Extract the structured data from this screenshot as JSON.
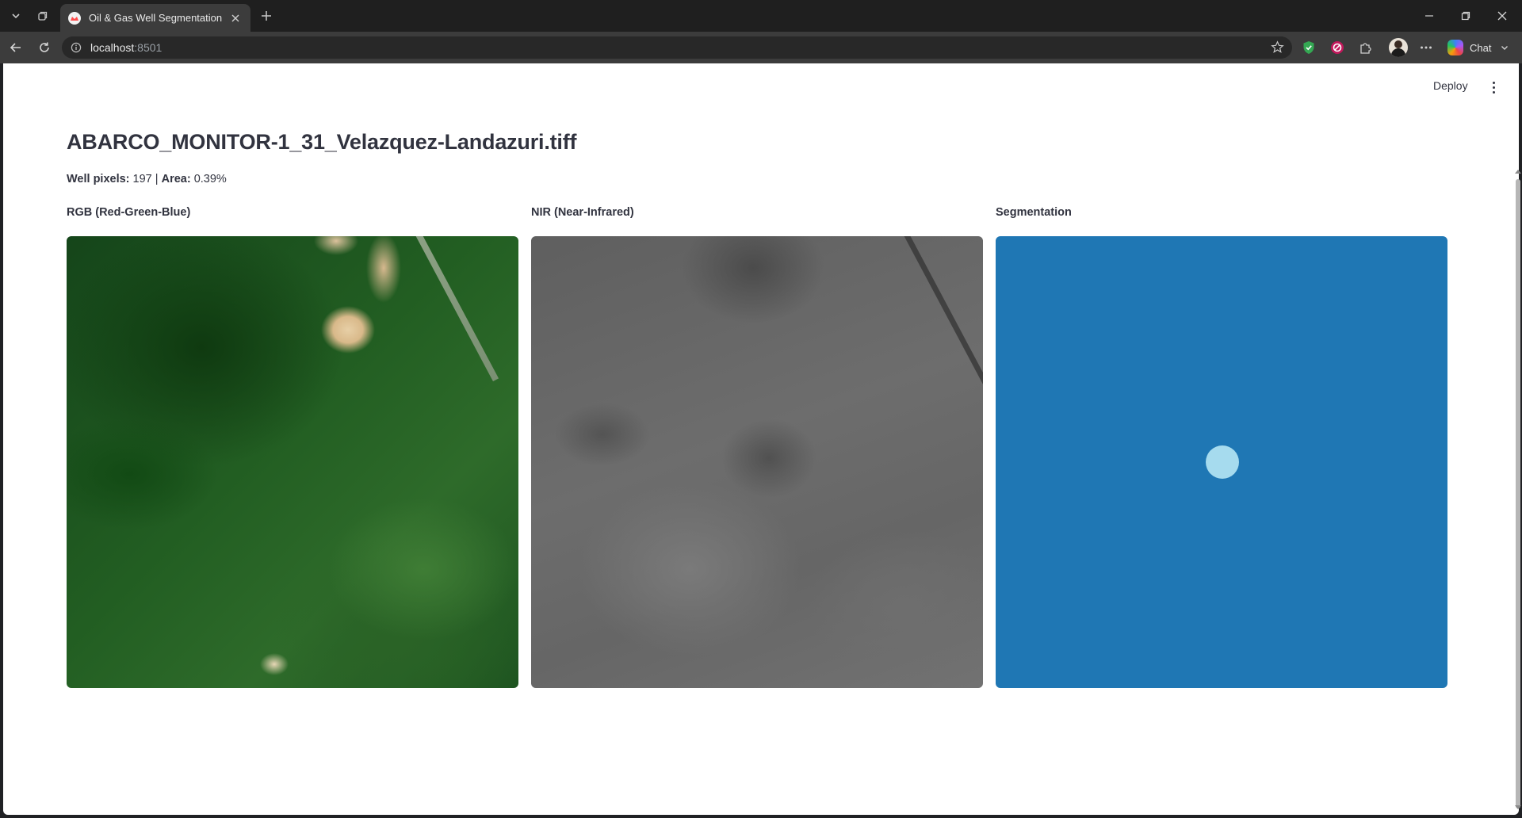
{
  "browser": {
    "tab_title": "Oil & Gas Well Segmentation",
    "url_host": "localhost",
    "url_port": ":8501",
    "chat_label": "Chat"
  },
  "app": {
    "deploy_label": "Deploy",
    "page_title": "ABARCO_MONITOR-1_31_Velazquez-Landazuri.tiff",
    "stats": {
      "well_pixels_label": "Well pixels:",
      "well_pixels_value": "197",
      "separator": "|",
      "area_label": "Area:",
      "area_value": "0.39%"
    },
    "columns": [
      {
        "label": "RGB (Red-Green-Blue)"
      },
      {
        "label": "NIR (Near-Infrared)"
      },
      {
        "label": "Segmentation"
      }
    ]
  },
  "colors": {
    "segmentation_background": "#1f77b4",
    "segmentation_well": "#a6dbee"
  },
  "icons": [
    "tab-list-icon",
    "tab-groups-icon",
    "new-tab-icon",
    "back-icon",
    "reload-icon",
    "site-info-icon",
    "bookmark-star-icon",
    "shield-extension-icon",
    "blocker-extension-icon",
    "extensions-puzzle-icon",
    "more-menu-icon",
    "minimize-icon",
    "restore-icon",
    "close-window-icon",
    "kebab-menu-icon"
  ]
}
